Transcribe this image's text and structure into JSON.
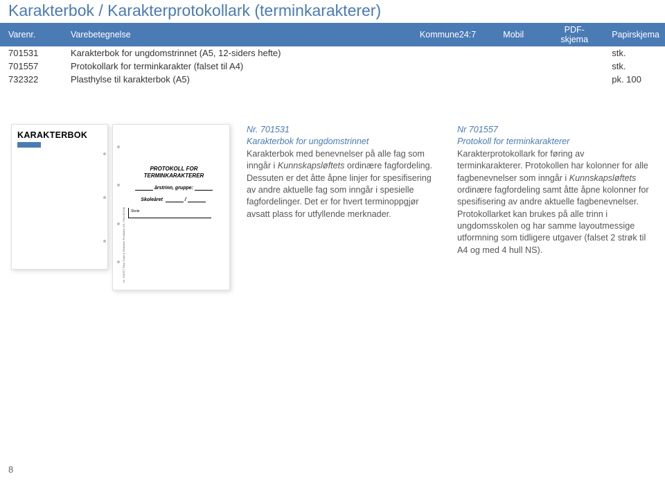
{
  "title": "Karakterbok / Karakterprotokollark (terminkarakterer)",
  "table": {
    "headers": {
      "varenr": "Varenr.",
      "betegnelse": "Varebetegnelse",
      "k24": "Kommune24:7",
      "mobil": "Mobil",
      "pdf": "PDF-skjema",
      "papir": "Papirskjema"
    },
    "rows": [
      {
        "varenr": "701531",
        "betegnelse": "Karakterbok for ungdomstrinnet (A5, 12-siders hefte)",
        "papir": "stk."
      },
      {
        "varenr": "701557",
        "betegnelse": "Protokollark for terminkarakter (falset til A4)",
        "papir": "stk."
      },
      {
        "varenr": "732322",
        "betegnelse": "Plasthylse til karakterbok (A5)",
        "papir": "pk. 100"
      }
    ]
  },
  "thumbs": {
    "karakterbok_label": "KARAKTERBOK",
    "protokoll_heading1": "PROTOKOLL FOR",
    "protokoll_heading2": "TERMINKARAKTERER",
    "protokoll_line1_suffix": "årstrinn, gruppe:",
    "protokoll_line2_prefix": "Skoleåret",
    "protokoll_skole": "Skole",
    "protokoll_side": "Nr. 701557    Flisa Trykk & Reklame Produkter AS, Flisa   8/2008"
  },
  "desc1": {
    "hdr": "Nr. 701531",
    "title": "Karakterbok for ungdomstrinnet",
    "body1a": "Karakterbok med benevnelser på alle fag som inngår i ",
    "body1b_em": "Kunnskapsløftets",
    "body1c": " ordinære fagfordeling. Dessuten er det åtte åpne linjer for spesifisering av andre aktuelle fag som inngår i spesielle fagfordelinger. Det er for hvert terminoppgjør avsatt plass for utfyllende merknader."
  },
  "desc2": {
    "hdr": "Nr 701557",
    "title": "Protokoll for terminkarakterer",
    "body2a": "Karakterprotokollark for føring av terminkarakterer. Protokollen har kolonner for alle fagbenevnelser som inngår i ",
    "body2b_em": "Kunnskapsløftets",
    "body2c": " ordinære fagfordeling samt åtte åpne kolonner for spesifisering av andre aktuelle fagbenevnelser. Protokollarket kan brukes på alle trinn i ungdomsskolen og har samme layoutmessige utformning som tidligere utgaver (falset 2 strøk til A4 og med 4 hull NS)."
  },
  "page_number": "8"
}
